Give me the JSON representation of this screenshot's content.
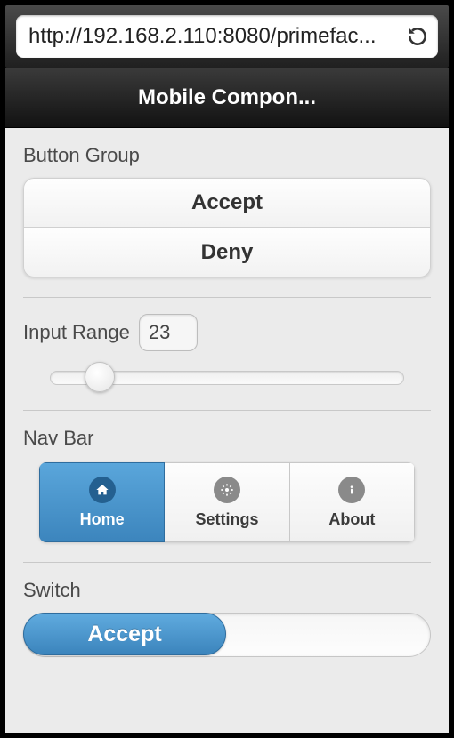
{
  "browser": {
    "url": "http://192.168.2.110:8080/primefac..."
  },
  "header": {
    "title": "Mobile Compon..."
  },
  "sections": {
    "button_group": {
      "label": "Button Group",
      "accept": "Accept",
      "deny": "Deny"
    },
    "input_range": {
      "label": "Input Range",
      "value": "23",
      "percent": 14
    },
    "navbar": {
      "label": "Nav Bar",
      "items": [
        {
          "label": "Home",
          "icon": "home-icon",
          "active": true
        },
        {
          "label": "Settings",
          "icon": "gear-icon",
          "active": false
        },
        {
          "label": "About",
          "icon": "info-icon",
          "active": false
        }
      ]
    },
    "switch": {
      "label": "Switch",
      "on_label": "Accept"
    }
  }
}
